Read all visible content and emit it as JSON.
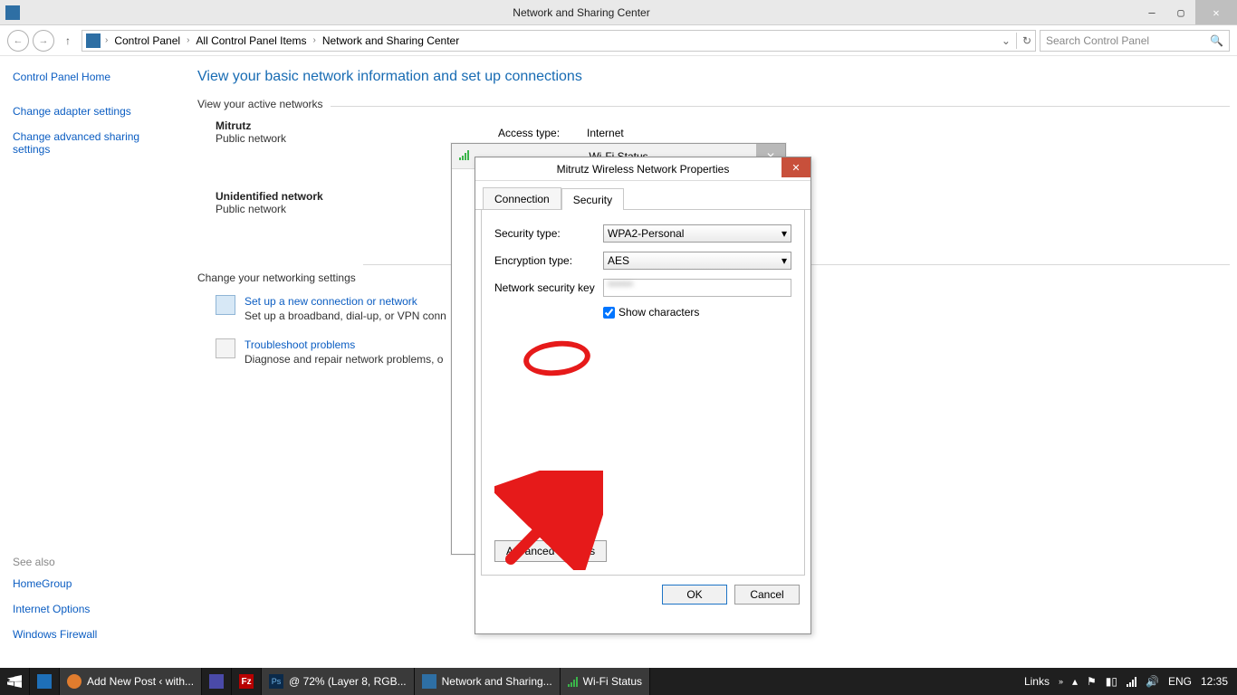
{
  "window": {
    "title": "Network and Sharing Center",
    "min": "—",
    "max": "▢",
    "close": "✕"
  },
  "addr": {
    "crumbs": [
      "Control Panel",
      "All Control Panel Items",
      "Network and Sharing Center"
    ],
    "dropdown_hint": "⌄",
    "refresh": "↻",
    "search_placeholder": "Search Control Panel"
  },
  "sidebar": {
    "home": "Control Panel Home",
    "links": [
      "Change adapter settings",
      "Change advanced sharing settings"
    ],
    "seealso_label": "See also",
    "seealso": [
      "HomeGroup",
      "Internet Options",
      "Windows Firewall"
    ]
  },
  "main": {
    "heading": "View your basic network information and set up connections",
    "active_label": "View your active networks",
    "net1_name": "Mitrutz",
    "net1_type": "Public network",
    "net2_name": "Unidentified network",
    "net2_type": "Public network",
    "access_label": "Access type:",
    "access_value": "Internet",
    "change_heading": "Change your networking settings",
    "setup_link": "Set up a new connection or network",
    "setup_desc": "Set up a broadband, dial-up, or VPN conn",
    "trouble_link": "Troubleshoot problems",
    "trouble_desc": "Diagnose and repair network problems, o"
  },
  "wifi_dialog": {
    "title": "Wi-Fi Status",
    "close": "✕"
  },
  "props_dialog": {
    "title": "Mitrutz Wireless Network Properties",
    "close": "✕",
    "tab_connection": "Connection",
    "tab_security": "Security",
    "sec_type_label": "Security type:",
    "sec_type_value": "WPA2-Personal",
    "enc_label": "Encryption type:",
    "enc_value": "AES",
    "key_label": "Network security key",
    "key_value": "******",
    "show_chars": "Show characters",
    "advanced": "Advanced settings",
    "ok": "OK",
    "cancel": "Cancel"
  },
  "taskbar": {
    "items": [
      "Add New Post ‹ with...",
      "",
      "",
      "@ 72% (Layer 8, RGB...",
      "Network and Sharing...",
      "Wi-Fi Status"
    ],
    "links": "Links",
    "lang": "ENG",
    "time": "12:35"
  }
}
